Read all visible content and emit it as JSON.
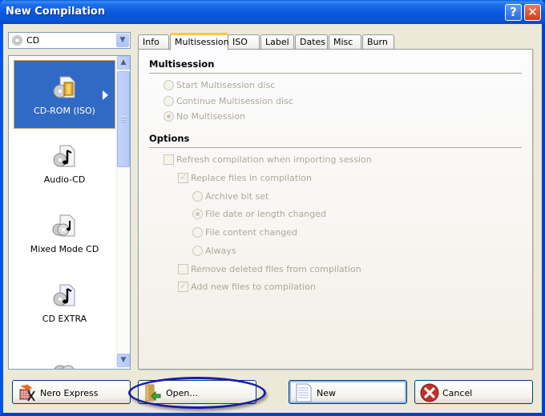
{
  "window": {
    "title": "New Compilation",
    "help_button": "?",
    "close_button": "✕"
  },
  "media_selector": {
    "value": "CD",
    "icon": "cd-disc-icon"
  },
  "compilation_types": [
    {
      "label": "CD-ROM (ISO)",
      "icon": "cd-rom-iso-icon",
      "selected": true
    },
    {
      "label": "Audio-CD",
      "icon": "audio-cd-icon",
      "selected": false
    },
    {
      "label": "Mixed Mode CD",
      "icon": "mixed-mode-cd-icon",
      "selected": false
    },
    {
      "label": "CD EXTRA",
      "icon": "cd-extra-icon",
      "selected": false
    },
    {
      "label": "",
      "icon": "cd-copy-icon",
      "selected": false
    }
  ],
  "tabs": [
    {
      "label": "Info",
      "active": false
    },
    {
      "label": "Multisession",
      "active": true
    },
    {
      "label": "ISO",
      "active": false
    },
    {
      "label": "Label",
      "active": false
    },
    {
      "label": "Dates",
      "active": false
    },
    {
      "label": "Misc",
      "active": false
    },
    {
      "label": "Burn",
      "active": false
    }
  ],
  "multisession": {
    "heading": "Multisession",
    "options": [
      {
        "label": "Start Multisession disc",
        "checked": false,
        "enabled": false
      },
      {
        "label": "Continue Multisession disc",
        "checked": false,
        "enabled": false
      },
      {
        "label": "No Multisession",
        "checked": true,
        "enabled": false
      }
    ]
  },
  "options": {
    "heading": "Options",
    "refresh_compilation": {
      "label": "Refresh compilation when importing session",
      "checked": false,
      "enabled": false
    },
    "replace_files": {
      "label": "Replace files in compilation",
      "checked": true,
      "enabled": false
    },
    "replace_criteria": [
      {
        "label": "Archive bit set",
        "checked": false,
        "enabled": false
      },
      {
        "label": "File date or length changed",
        "checked": true,
        "enabled": false
      },
      {
        "label": "File content changed",
        "checked": false,
        "enabled": false
      },
      {
        "label": "Always",
        "checked": false,
        "enabled": false
      }
    ],
    "remove_deleted": {
      "label": "Remove deleted files from compilation",
      "checked": false,
      "enabled": false
    },
    "add_new": {
      "label": "Add new files to compilation",
      "checked": true,
      "enabled": false
    }
  },
  "buttons": {
    "nero_express": "Nero Express",
    "open": "Open...",
    "new": "New",
    "cancel": "Cancel"
  },
  "annotation": {
    "highlighted_button": "open"
  }
}
